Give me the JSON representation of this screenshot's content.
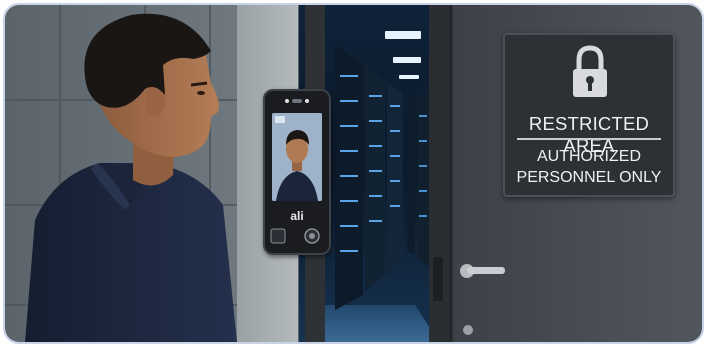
{
  "sign": {
    "line1": "RESTRICTED AREA",
    "line2": "AUTHORIZED",
    "line3": "PERSONNEL ONLY"
  },
  "terminal": {
    "logo": "ali"
  },
  "colors": {
    "frame_border": "#c9d3e6",
    "sign_background": "#2d3136",
    "door": "#45494f",
    "corridor_light": "#5aa3e6",
    "shirt": "#1d2740"
  }
}
